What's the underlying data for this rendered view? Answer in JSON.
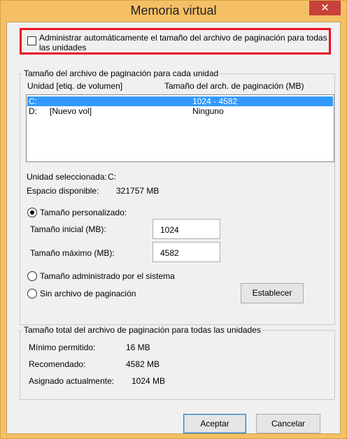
{
  "window": {
    "title": "Memoria virtual",
    "close_glyph": "✕"
  },
  "auto_manage": {
    "label": "Administrar automáticamente el tamaño del archivo de paginación para todas las unidades",
    "checked": false
  },
  "per_drive": {
    "group_title": "Tamaño del archivo de paginación para cada unidad",
    "col_drive": "Unidad [etiq. de volumen]",
    "col_size": "Tamaño del arch. de paginación (MB)",
    "rows": [
      {
        "drive": "C:",
        "label": "",
        "size": "1024 - 4582",
        "selected": true
      },
      {
        "drive": "D:",
        "label": "[Nuevo vol]",
        "size": "Ninguno",
        "selected": false
      }
    ],
    "selected_drive_label": "Unidad seleccionada:",
    "selected_drive_value": "C:",
    "free_space_label": "Espacio disponible:",
    "free_space_value": "321757 MB"
  },
  "options": {
    "custom_size": "Tamaño personalizado:",
    "initial_label": "Tamaño inicial (MB):",
    "initial_value": "1024",
    "max_label": "Tamaño máximo (MB):",
    "max_value": "4582",
    "system_managed": "Tamaño administrado por el sistema",
    "no_paging": "Sin archivo de paginación",
    "set_button": "Establecer",
    "selected": "custom"
  },
  "totals": {
    "group_title": "Tamaño total del archivo de paginación para todas las unidades",
    "min_label": "Mínimo permitido:",
    "min_value": "16 MB",
    "recommended_label": "Recomendado:",
    "recommended_value": "4582 MB",
    "allocated_label": "Asignado actualmente:",
    "allocated_value": "1024 MB"
  },
  "footer": {
    "ok": "Aceptar",
    "cancel": "Cancelar"
  },
  "colors": {
    "title_bar": "#f5c065",
    "close": "#c7403a",
    "highlight_border": "#e81123",
    "selection": "#3399ff"
  }
}
